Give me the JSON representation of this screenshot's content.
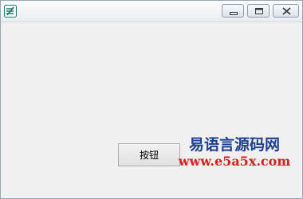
{
  "window": {
    "app_icon": "easy-language-app-icon",
    "controls": {
      "minimize_icon": "minimize-icon",
      "maximize_icon": "maximize-icon",
      "close_icon": "close-icon"
    }
  },
  "main": {
    "button_label": "按钮"
  },
  "watermark": {
    "title": "易语言源码网",
    "url": "www.e5a5x.com"
  },
  "colors": {
    "client_background": "#f0f0f0",
    "watermark_title": "#1d3f94",
    "watermark_url": "#e11b1b"
  }
}
